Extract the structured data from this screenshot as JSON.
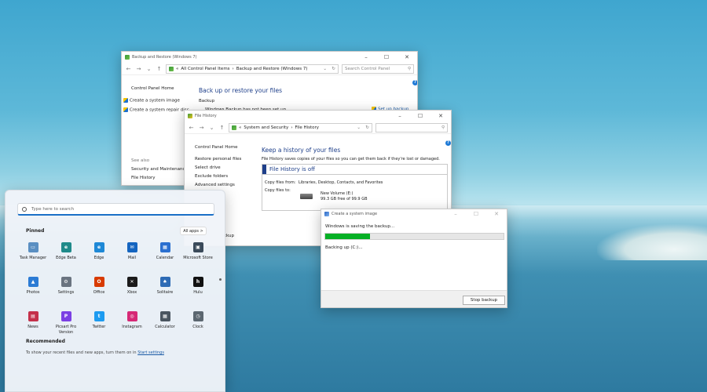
{
  "colors": {
    "accent": "#1a6fc7",
    "progress": "#06b025",
    "heading": "#1e3f8a",
    "link": "#1a5aa5"
  },
  "backup_window": {
    "title": "Backup and Restore (Windows 7)",
    "breadcrumb_sep": "«",
    "breadcrumb": [
      "All Control Panel Items",
      "Backup and Restore (Windows 7)"
    ],
    "search_placeholder": "Search Control Panel",
    "nav": [
      "Control Panel Home",
      "Create a system image",
      "Create a system repair disc"
    ],
    "see_also": "See also",
    "see_also_links": [
      "Security and Maintenance",
      "File History"
    ],
    "heading": "Back up or restore your files",
    "backup_label": "Backup",
    "backup_status": "Windows Backup has not been set up.",
    "setup_link": "Set up backup",
    "restore_partial": "ckup"
  },
  "file_history_window": {
    "title": "File History",
    "breadcrumb_sep": "«",
    "breadcrumb": [
      "System and Security",
      "File History"
    ],
    "nav": [
      "Control Panel Home",
      "Restore personal files",
      "Select drive",
      "Exclude folders",
      "Advanced settings"
    ],
    "heading": "Keep a history of your files",
    "description": "File History saves copies of your files so you can get them back if they're lost or damaged.",
    "status_title": "File History is off",
    "copy_from_label": "Copy files from:",
    "copy_from_value": "Libraries, Desktop, Contacts, and Favorites",
    "copy_to_label": "Copy files to:",
    "drive_name": "New Volume (E:)",
    "drive_space": "99.3 GB free of 99.9 GB"
  },
  "system_image_window": {
    "title": "Create a system image",
    "status": "Windows is saving the backup...",
    "progress": 0.25,
    "detail": "Backing up (C:)...",
    "stop_button": "Stop backup"
  },
  "start_menu": {
    "search_placeholder": "Type here to search",
    "pinned_title": "Pinned",
    "all_apps": "All apps  >",
    "apps": [
      {
        "label": "Task Manager",
        "icon": "task-manager-icon",
        "color": "#5a8fc2",
        "glyph": "▭"
      },
      {
        "label": "Edge Beta",
        "icon": "edge-beta-icon",
        "color": "#1f8a8a",
        "glyph": "e"
      },
      {
        "label": "Edge",
        "icon": "edge-icon",
        "color": "#1e88d6",
        "glyph": "e"
      },
      {
        "label": "Mail",
        "icon": "mail-icon",
        "color": "#1565c0",
        "glyph": "✉"
      },
      {
        "label": "Calendar",
        "icon": "calendar-icon",
        "color": "#2a6fd0",
        "glyph": "▦"
      },
      {
        "label": "Microsoft Store",
        "icon": "store-icon",
        "color": "#3a4a5a",
        "glyph": "▣"
      },
      {
        "label": "Photos",
        "icon": "photos-icon",
        "color": "#2b7bd4",
        "glyph": "▲"
      },
      {
        "label": "Settings",
        "icon": "settings-icon",
        "color": "#6a7480",
        "glyph": "⚙"
      },
      {
        "label": "Office",
        "icon": "office-icon",
        "color": "#d83b01",
        "glyph": "O"
      },
      {
        "label": "Xbox",
        "icon": "xbox-icon",
        "color": "#1b1b1b",
        "glyph": "✕"
      },
      {
        "label": "Solitaire",
        "icon": "solitaire-icon",
        "color": "#2d6bb5",
        "glyph": "♠"
      },
      {
        "label": "Hulu",
        "icon": "hulu-icon",
        "color": "#111111",
        "glyph": "h"
      },
      {
        "label": "News",
        "icon": "news-icon",
        "color": "#c4314b",
        "glyph": "▤"
      },
      {
        "label": "Picsart Pro Version",
        "icon": "picsart-icon",
        "color": "#7b3fe4",
        "glyph": "P"
      },
      {
        "label": "Twitter",
        "icon": "twitter-icon",
        "color": "#1d9bf0",
        "glyph": "t"
      },
      {
        "label": "Instagram",
        "icon": "instagram-icon",
        "color": "#d62976",
        "glyph": "◎"
      },
      {
        "label": "Calculator",
        "icon": "calculator-icon",
        "color": "#4a5560",
        "glyph": "▦"
      },
      {
        "label": "Clock",
        "icon": "clock-icon",
        "color": "#5b6670",
        "glyph": "◷"
      }
    ],
    "recommended_title": "Recommended",
    "recommended_text": "To show your recent files and new apps, turn them on in",
    "recommended_link": "Start settings"
  }
}
